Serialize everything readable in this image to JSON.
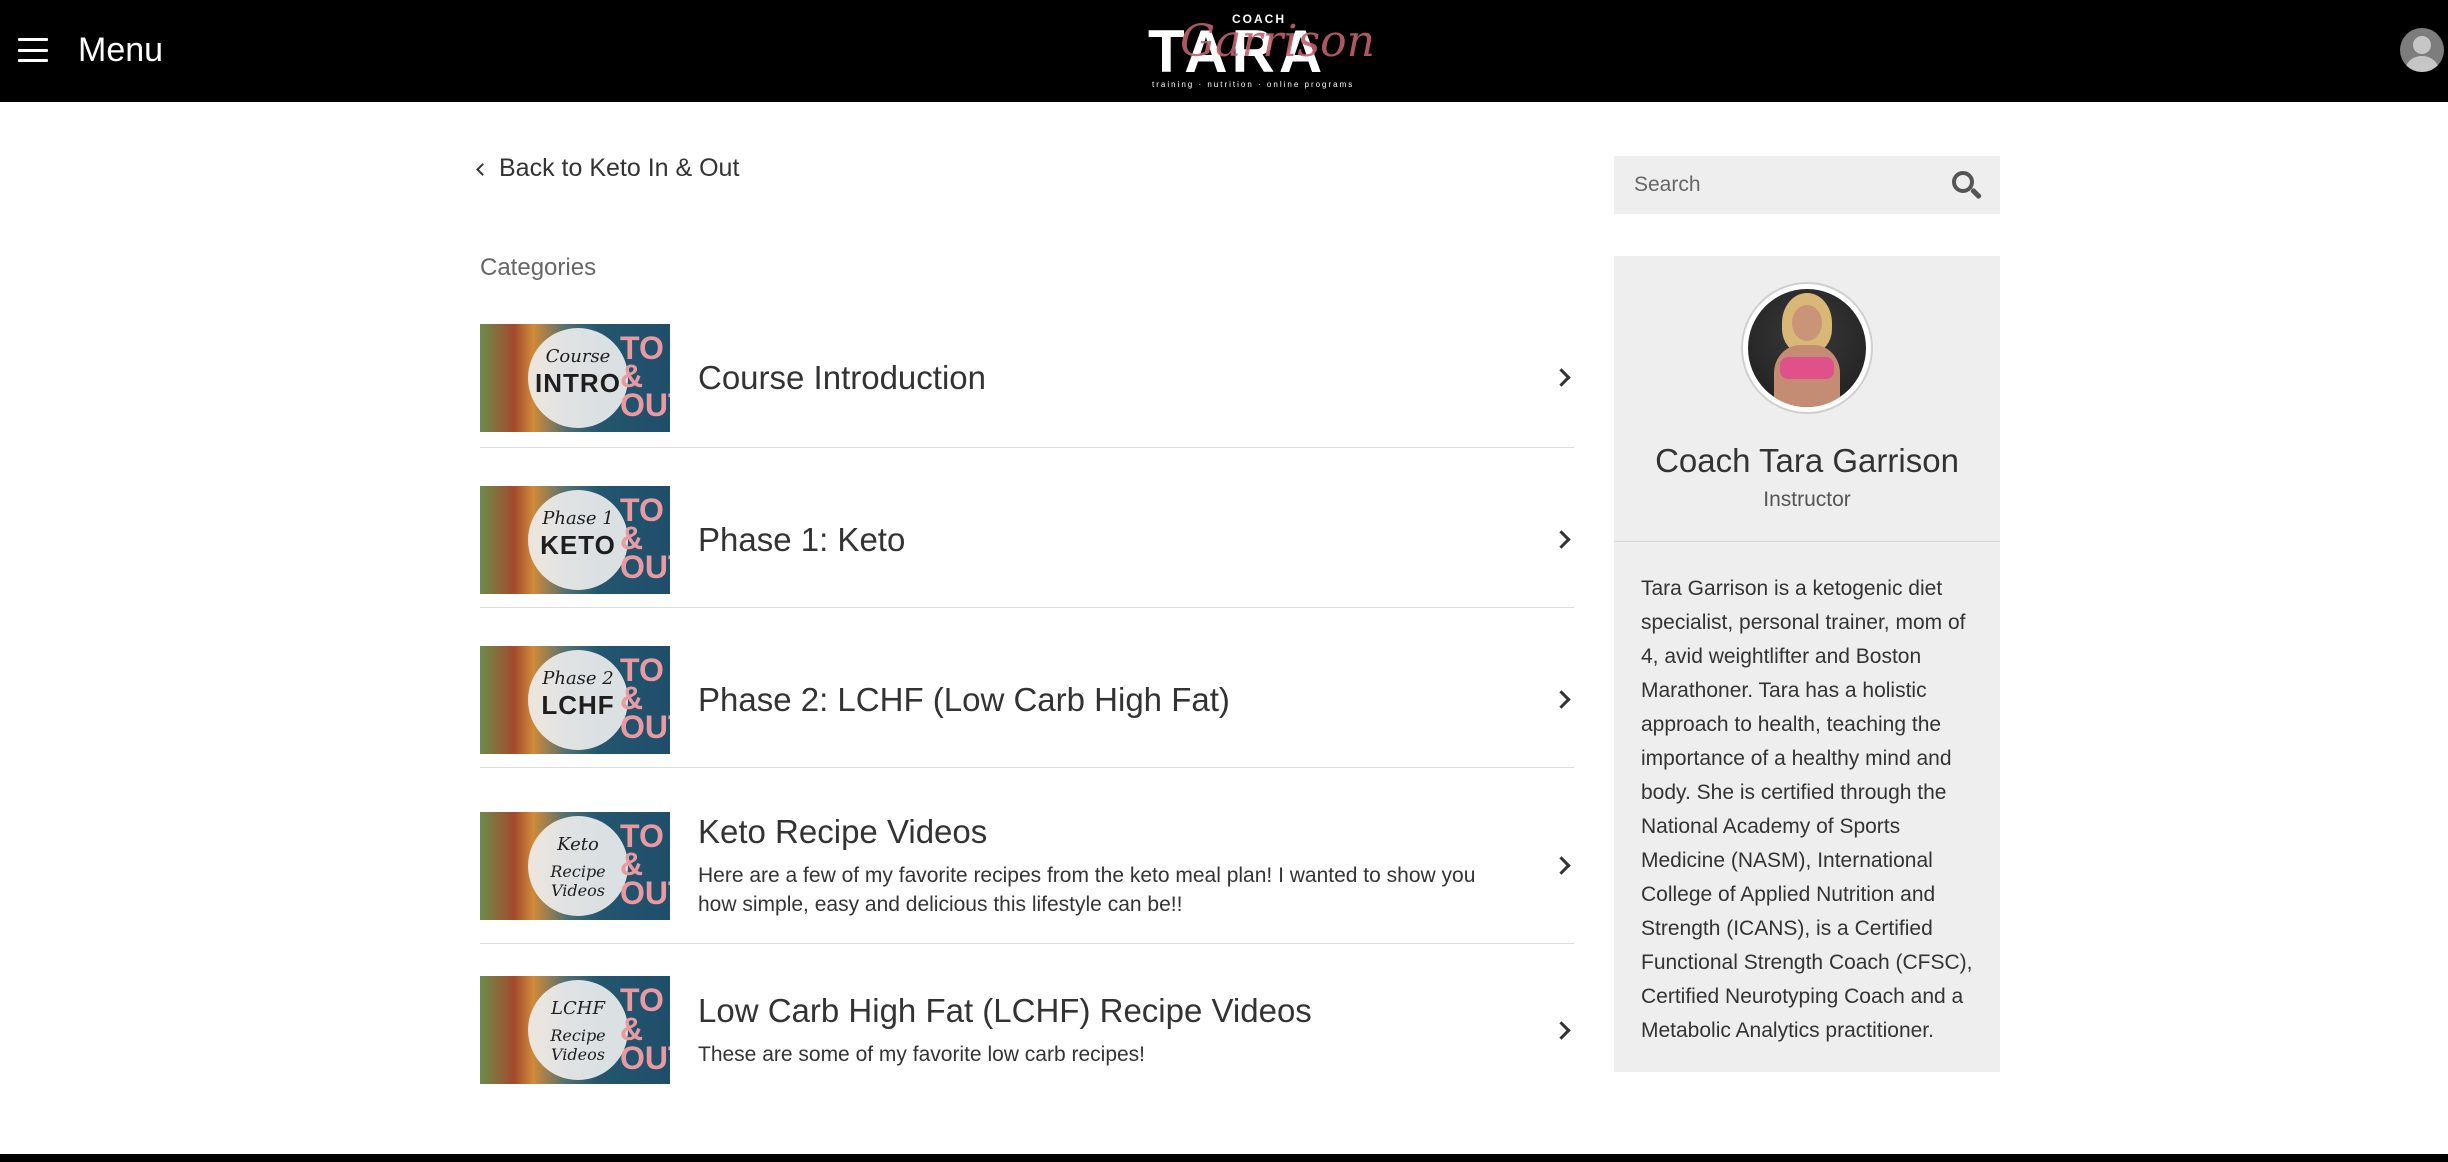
{
  "header": {
    "menu_label": "Menu",
    "logo": {
      "coach": "COACH",
      "tara": "TARA",
      "script": "Garrison",
      "tagline": "training · nutrition · online programs"
    }
  },
  "back_link": "Back to Keto In & Out",
  "categories_heading": "Categories",
  "categories": [
    {
      "thumb_line1": "Course",
      "thumb_line2": "INTRO",
      "title": "Course Introduction",
      "description": ""
    },
    {
      "thumb_line1": "Phase 1",
      "thumb_line2": "KETO",
      "title": "Phase 1: Keto",
      "description": ""
    },
    {
      "thumb_line1": "Phase 2",
      "thumb_line2": "LCHF",
      "title": "Phase 2: LCHF (Low Carb High Fat)",
      "description": ""
    },
    {
      "thumb_line1": "Keto",
      "thumb_line2": "Recipe Videos",
      "title": "Keto Recipe Videos",
      "description": "Here are a few of my favorite recipes from the keto meal plan! I wanted to show you how simple, easy and delicious this lifestyle can be!!"
    },
    {
      "thumb_line1": "LCHF",
      "thumb_line2": "Recipe Videos",
      "title": "Low Carb High Fat (LCHF) Recipe Videos",
      "description": "These are some of my favorite low carb recipes!"
    }
  ],
  "thumb_overlay": "TO & OUT",
  "search": {
    "placeholder": "Search"
  },
  "instructor": {
    "name": "Coach Tara Garrison",
    "role": "Instructor",
    "bio": "Tara Garrison is a ketogenic diet specialist, personal trainer, mom of 4, avid weightlifter and Boston Marathoner. Tara has a holistic approach to health, teaching the importance of a healthy mind and body. She is certified through the National Academy of Sports Medicine (NASM), International College of Applied Nutrition and Strength (ICANS), is a Certified Functional Strength Coach (CFSC), Certified Neurotyping Coach and a Metabolic Analytics practitioner."
  },
  "colors": {
    "header_bg": "#000000",
    "sidebar_bg": "#eeeeee",
    "logo_accent": "#c0616e",
    "thumb_overlay_text": "#e89aa0"
  }
}
